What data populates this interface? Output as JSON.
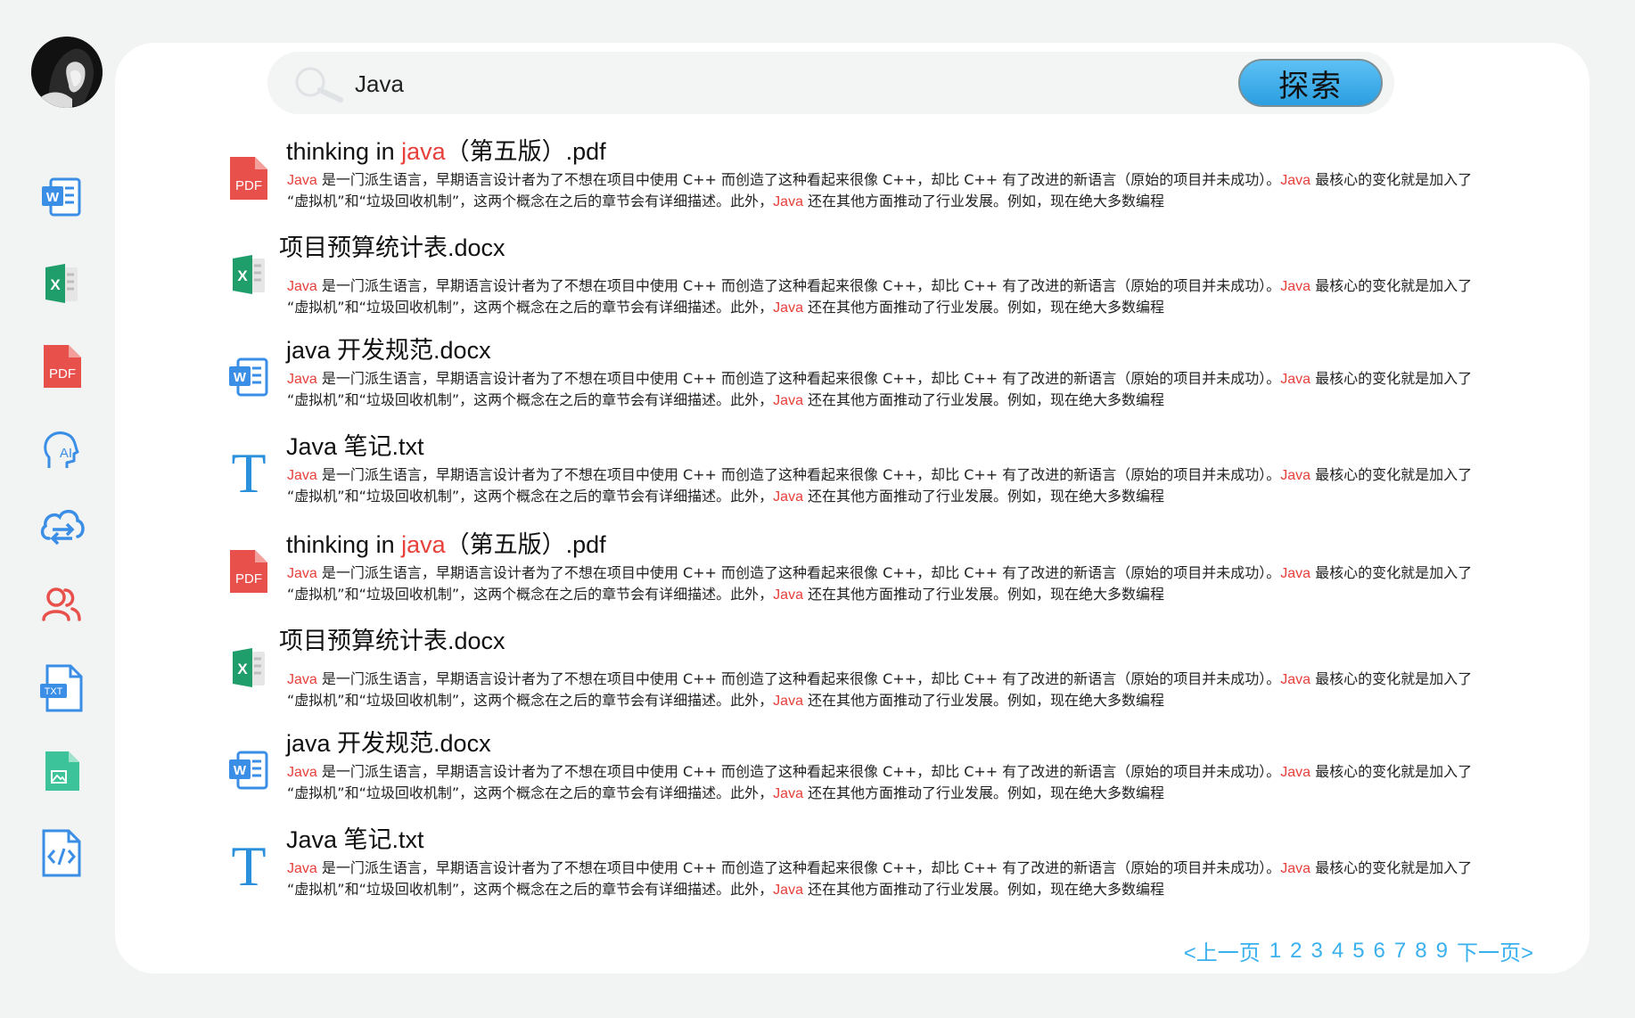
{
  "search": {
    "query": "Java",
    "button_label": "探索"
  },
  "sidebar": {
    "items": [
      {
        "icon": "word-icon"
      },
      {
        "icon": "excel-icon"
      },
      {
        "icon": "pdf-icon"
      },
      {
        "icon": "ai-icon"
      },
      {
        "icon": "cloud-sync-icon"
      },
      {
        "icon": "users-icon"
      },
      {
        "icon": "txt-icon"
      },
      {
        "icon": "image-file-icon"
      },
      {
        "icon": "code-file-icon"
      }
    ],
    "pdf_label": "PDF",
    "txt_label": "TXT"
  },
  "results": [
    {
      "type": "pdf",
      "title_pre": "thinking in ",
      "title_hl": "java",
      "title_post": "（第五版）.pdf"
    },
    {
      "type": "excel",
      "title_pre": "项目预算统计表.docx",
      "title_hl": "",
      "title_post": ""
    },
    {
      "type": "word",
      "title_pre": "java 开发规范.docx",
      "title_hl": "",
      "title_post": ""
    },
    {
      "type": "txt",
      "title_pre": "Java 笔记.txt",
      "title_hl": "",
      "title_post": ""
    },
    {
      "type": "pdf",
      "title_pre": "thinking in ",
      "title_hl": "java",
      "title_post": "（第五版）.pdf"
    },
    {
      "type": "excel",
      "title_pre": "项目预算统计表.docx",
      "title_hl": "",
      "title_post": ""
    },
    {
      "type": "word",
      "title_pre": "java 开发规范.docx",
      "title_hl": "",
      "title_post": ""
    },
    {
      "type": "txt",
      "title_pre": "Java 笔记.txt",
      "title_hl": "",
      "title_post": ""
    }
  ],
  "snippet": {
    "hl1": "Java",
    "t1": " 是一门派生语言，早期语言设计者为了不想在项目中使用 C++ 而创造了这种看起来很像 C++，却比 C++ 有了改进的新语言（原始的项目并未成功）。",
    "hl2": "Java",
    "t2": " 最核心的变化就是加入了",
    "t3": "“虚拟机”和“垃圾回收机制”，这两个概念在之后的章节会有详细描述。此外，",
    "hl3": "Java",
    "t4": " 还在其他方面推动了行业发展。例如，现在绝大多数编程"
  },
  "pagination": {
    "prev": "<上一页",
    "pages": [
      "1",
      "2",
      "3",
      "4",
      "5",
      "6",
      "7",
      "8",
      "9"
    ],
    "next": "下一页>"
  },
  "colors": {
    "highlight": "#e8403a",
    "link": "#3ab0ee",
    "word": "#3a8ee6",
    "excel": "#1f9d6b",
    "pdf": "#e8504c"
  }
}
